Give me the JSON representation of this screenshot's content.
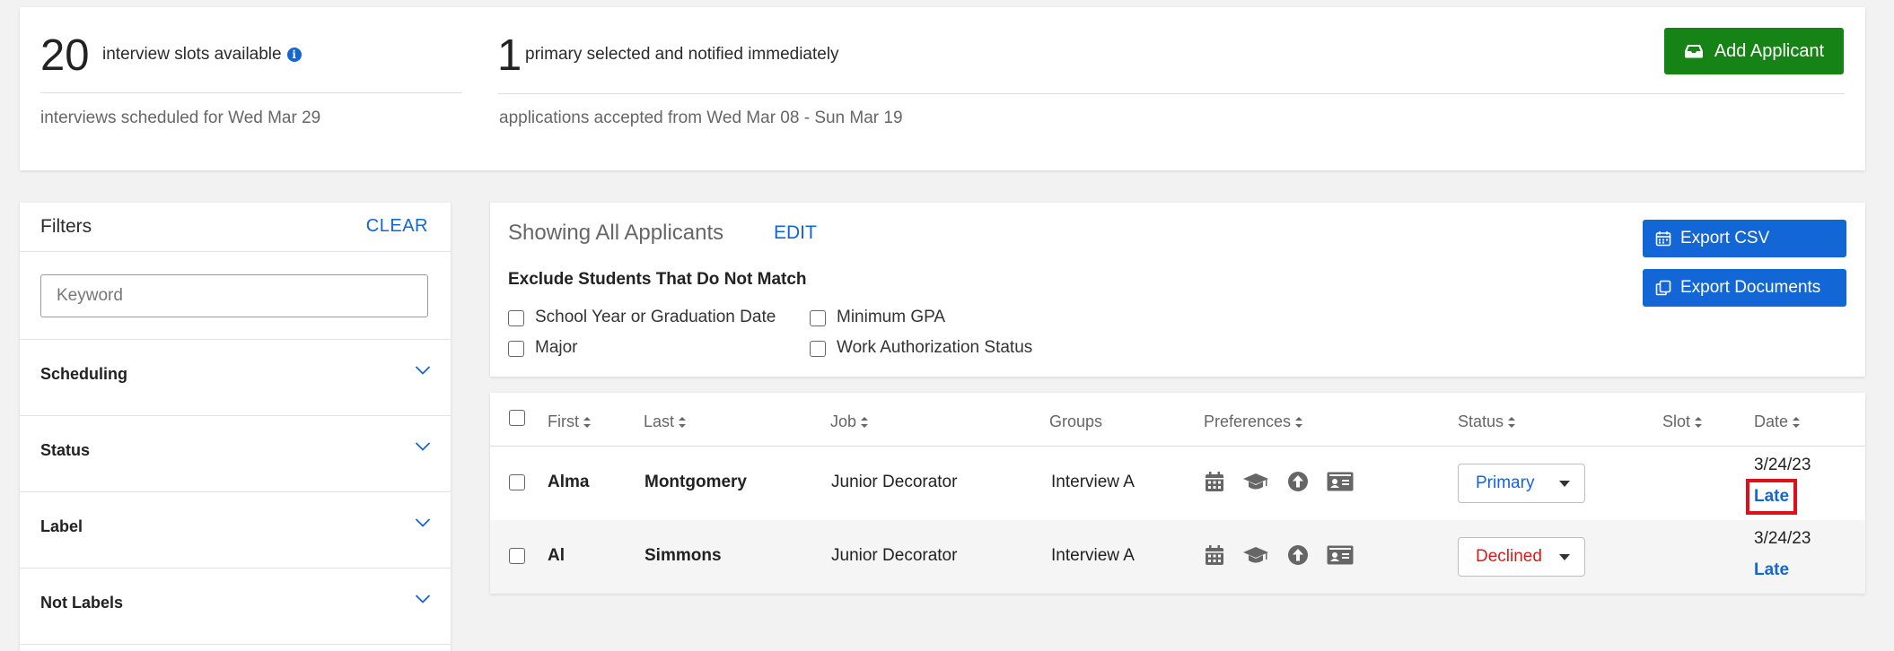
{
  "summary": {
    "slots_count": "20",
    "slots_label": "interview slots available",
    "slots_sub": "interviews scheduled for Wed Mar 29",
    "primary_count": "1",
    "primary_label": "primary selected and notified immediately",
    "primary_sub": "applications accepted from Wed Mar 08 - Sun Mar 19",
    "add_button": "Add Applicant"
  },
  "filters": {
    "title": "Filters",
    "clear": "CLEAR",
    "keyword_placeholder": "Keyword",
    "sections": [
      "Scheduling",
      "Status",
      "Label",
      "Not Labels"
    ]
  },
  "applicants_panel": {
    "title": "Showing All Applicants",
    "edit": "EDIT",
    "exclude_heading": "Exclude Students That Do Not Match",
    "options": [
      "School Year or Graduation Date",
      "Minimum GPA",
      "Major",
      "Work Authorization Status"
    ],
    "export_csv": "Export CSV",
    "export_documents": "Export Documents"
  },
  "table": {
    "columns": [
      "First",
      "Last",
      "Job",
      "Groups",
      "Preferences",
      "Status",
      "Slot",
      "Date"
    ],
    "rows": [
      {
        "first": "Alma",
        "last": "Montgomery",
        "job": "Junior Decorator",
        "group": "Interview A",
        "status": "Primary",
        "date": "3/24/23",
        "late": "Late"
      },
      {
        "first": "Al",
        "last": "Simmons",
        "job": "Junior Decorator",
        "group": "Interview A",
        "status": "Declined",
        "date": "3/24/23",
        "late": "Late"
      }
    ]
  },
  "colors": {
    "accent": "#1366d6",
    "add_button": "#168317",
    "declined": "#d81b1b",
    "highlight": "#e0101a"
  },
  "icons": [
    "info-icon",
    "inbox-icon",
    "chevron-down-icon",
    "calendar-icon",
    "graduation-cap-icon",
    "arrow-up-circle-icon",
    "id-card-icon",
    "copy-icon",
    "sort-icon"
  ]
}
